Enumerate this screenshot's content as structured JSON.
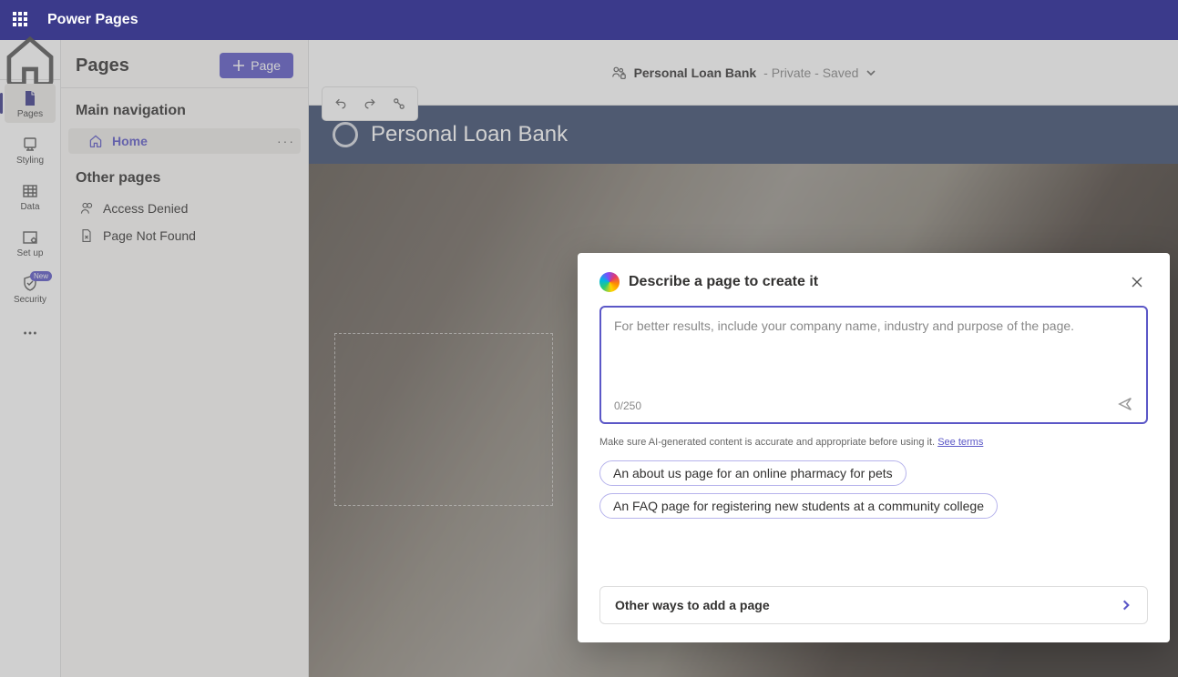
{
  "header": {
    "product": "Power Pages"
  },
  "rail": [
    {
      "key": "pages",
      "label": "Pages"
    },
    {
      "key": "styling",
      "label": "Styling"
    },
    {
      "key": "data",
      "label": "Data"
    },
    {
      "key": "setup",
      "label": "Set up"
    },
    {
      "key": "security",
      "label": "Security",
      "badge": "New"
    }
  ],
  "pagesPanel": {
    "title": "Pages",
    "addButton": "Page",
    "mainNavLabel": "Main navigation",
    "homeLabel": "Home",
    "otherPagesLabel": "Other pages",
    "otherPages": [
      {
        "label": "Access Denied",
        "icon": "user"
      },
      {
        "label": "Page Not Found",
        "icon": "file"
      }
    ]
  },
  "sitePicker": {
    "name": "Personal Loan Bank",
    "status": "- Private - Saved"
  },
  "siteHeader": {
    "title": "Personal Loan Bank"
  },
  "dialog": {
    "title": "Describe a page to create it",
    "placeholder": "For better results, include your company name, industry and purpose of the page.",
    "charCount": "0/250",
    "disclaimer": "Make sure AI-generated content is accurate and appropriate before using it.",
    "termsLink": "See terms",
    "suggestions": [
      "An about us page for an online pharmacy for pets",
      "An FAQ page for registering new students at a community college"
    ],
    "otherWays": "Other ways to add a page"
  }
}
